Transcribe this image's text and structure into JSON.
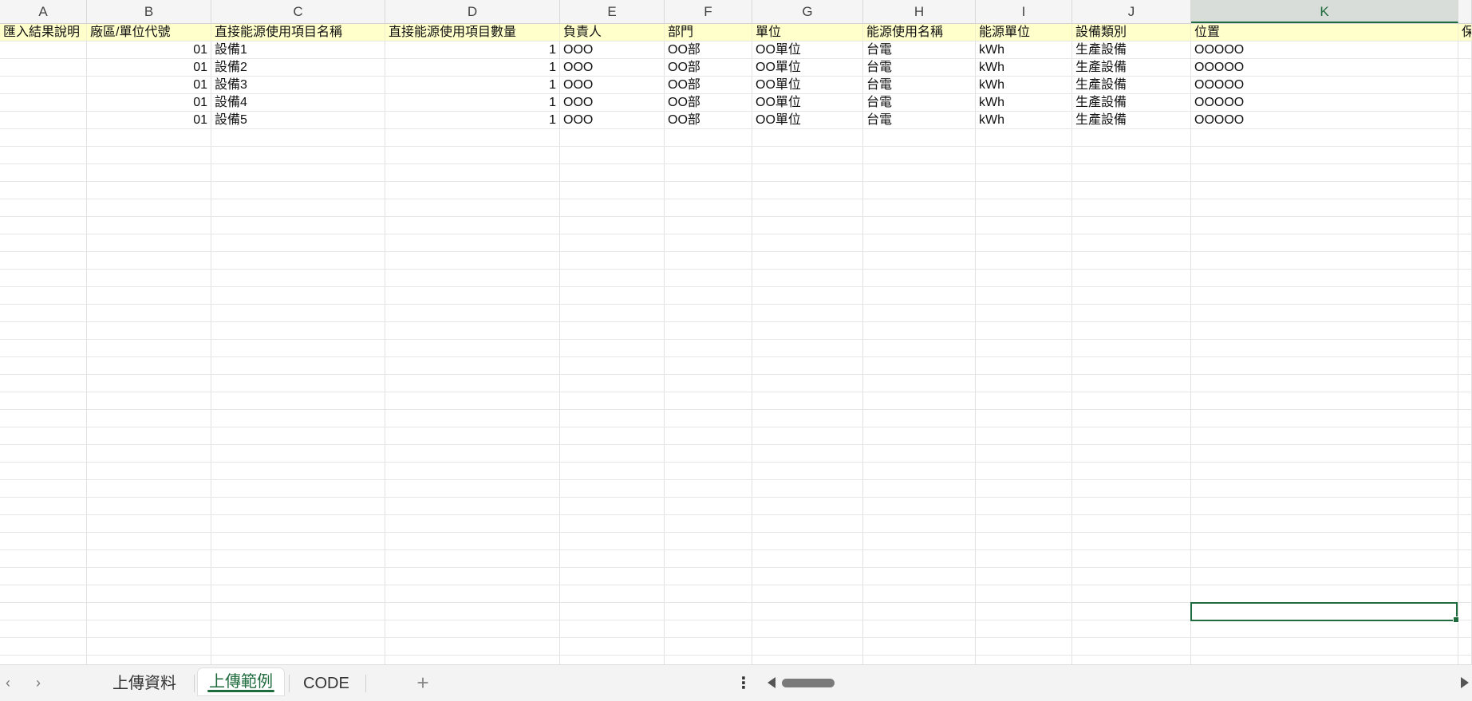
{
  "columns": [
    "A",
    "B",
    "C",
    "D",
    "E",
    "F",
    "G",
    "H",
    "I",
    "J",
    "K"
  ],
  "selected_column": "K",
  "header_row": [
    "匯入結果說明",
    "廠區/單位代號",
    "直接能源使用項目名稱",
    "直接能源使用項目數量",
    "負責人",
    "部門",
    "單位",
    "能源使用名稱",
    "能源單位",
    "設備類別",
    "位置",
    "保"
  ],
  "rows": [
    [
      "",
      "01",
      "設備1",
      "1",
      "OOO",
      "OO部",
      "OO單位",
      "台電",
      "kWh",
      "生產設備",
      "OOOOO"
    ],
    [
      "",
      "01",
      "設備2",
      "1",
      "OOO",
      "OO部",
      "OO單位",
      "台電",
      "kWh",
      "生產設備",
      "OOOOO"
    ],
    [
      "",
      "01",
      "設備3",
      "1",
      "OOO",
      "OO部",
      "OO單位",
      "台電",
      "kWh",
      "生產設備",
      "OOOOO"
    ],
    [
      "",
      "01",
      "設備4",
      "1",
      "OOO",
      "OO部",
      "OO單位",
      "台電",
      "kWh",
      "生產設備",
      "OOOOO"
    ],
    [
      "",
      "01",
      "設備5",
      "1",
      "OOO",
      "OO部",
      "OO單位",
      "台電",
      "kWh",
      "生產設備",
      "OOOOO"
    ]
  ],
  "sheet_tabs": [
    {
      "label": "上傳資料",
      "active": false
    },
    {
      "label": "上傳範例",
      "active": true
    },
    {
      "label": "CODE",
      "active": false
    }
  ],
  "icons": {
    "prev": "chevron-left-icon",
    "next": "chevron-right-icon",
    "add": "plus-icon",
    "more": "more-vertical-icon"
  },
  "colors": {
    "accent": "#1e6b3d",
    "header_fill": "#ffffcc"
  }
}
